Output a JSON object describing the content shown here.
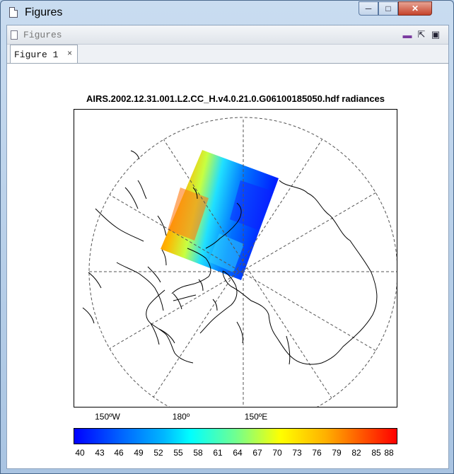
{
  "window": {
    "title": "Figures",
    "icon": "document-icon",
    "buttons": {
      "minimize": "minimize-icon",
      "maximize": "maximize-icon",
      "close": "close-icon"
    }
  },
  "panel": {
    "title": "Figures",
    "tools": [
      "minimize-panel-icon",
      "undock-icon",
      "maximize-panel-icon"
    ]
  },
  "tabs": [
    {
      "label": "Figure 1",
      "close": "×",
      "active": true
    }
  ],
  "figure": {
    "title": "AIRS.2002.12.31.001.L2.CC_H.v4.0.21.0.G06100185050.hdf radiances",
    "projection": "south-polar-stereographic",
    "lon_labels": [
      "150ºW",
      "180º",
      "150ºE"
    ],
    "colorbar": {
      "ticks": [
        "40",
        "43",
        "46",
        "49",
        "52",
        "55",
        "58",
        "61",
        "64",
        "67",
        "70",
        "73",
        "76",
        "79",
        "82",
        "85",
        "88"
      ],
      "min": 40,
      "max": 89,
      "colormap": [
        "#0000ff",
        "#00b8ff",
        "#00ffff",
        "#70ff90",
        "#ffff00",
        "#ff8000",
        "#ff0000"
      ]
    }
  }
}
